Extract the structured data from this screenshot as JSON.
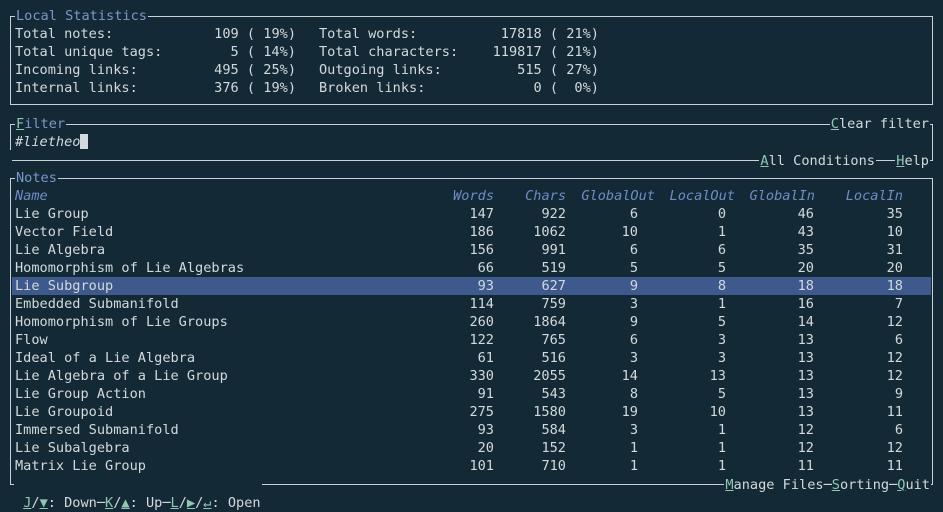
{
  "stats": {
    "title": "Local Statistics",
    "rows": [
      {
        "l1": "Total notes:",
        "v1": "109 ( 19%)",
        "l2": "Total words:",
        "v2": "17818 ( 21%)"
      },
      {
        "l1": "Total unique tags:",
        "v1": "5 ( 14%)",
        "l2": "Total characters:",
        "v2": "119817 ( 21%)"
      },
      {
        "l1": "Incoming links:",
        "v1": "495 ( 25%)",
        "l2": "Outgoing links:",
        "v2": "515 ( 27%)"
      },
      {
        "l1": "Internal links:",
        "v1": "376 ( 19%)",
        "l2": "Broken links:",
        "v2": "0 (  0%)"
      }
    ]
  },
  "filter": {
    "title_key": "F",
    "title_rest": "ilter",
    "value": "#lietheo",
    "clear_key": "C",
    "clear_rest": "lear filter",
    "all_key": "A",
    "all_rest": "ll Conditions",
    "help_key": "H",
    "help_rest": "elp"
  },
  "notes": {
    "title": "Notes",
    "headers": [
      "Name",
      "Words",
      "Chars",
      "GlobalOut",
      "LocalOut",
      "GlobalIn",
      "LocalIn"
    ],
    "rows": [
      [
        "Lie Group",
        "147",
        "922",
        "6",
        "0",
        "46",
        "35"
      ],
      [
        "Vector Field",
        "186",
        "1062",
        "10",
        "1",
        "43",
        "10"
      ],
      [
        "Lie Algebra",
        "156",
        "991",
        "6",
        "6",
        "35",
        "31"
      ],
      [
        "Homomorphism of Lie Algebras",
        "66",
        "519",
        "5",
        "5",
        "20",
        "20"
      ],
      [
        "Lie Subgroup",
        "93",
        "627",
        "9",
        "8",
        "18",
        "18"
      ],
      [
        "Embedded Submanifold",
        "114",
        "759",
        "3",
        "1",
        "16",
        "7"
      ],
      [
        "Homomorphism of Lie Groups",
        "260",
        "1864",
        "9",
        "5",
        "14",
        "12"
      ],
      [
        "Flow",
        "122",
        "765",
        "6",
        "3",
        "13",
        "6"
      ],
      [
        "Ideal of a Lie Algebra",
        "61",
        "516",
        "3",
        "3",
        "13",
        "12"
      ],
      [
        "Lie Algebra of a Lie Group",
        "330",
        "2055",
        "14",
        "13",
        "13",
        "12"
      ],
      [
        "Lie Group Action",
        "91",
        "543",
        "8",
        "5",
        "13",
        "9"
      ],
      [
        "Lie Groupoid",
        "275",
        "1580",
        "19",
        "10",
        "13",
        "11"
      ],
      [
        "Immersed Submanifold",
        "93",
        "584",
        "3",
        "1",
        "12",
        "6"
      ],
      [
        "Lie Subalgebra",
        "20",
        "152",
        "1",
        "1",
        "12",
        "12"
      ],
      [
        "Matrix Lie Group",
        "101",
        "710",
        "1",
        "1",
        "11",
        "11"
      ]
    ],
    "selected_index": 4
  },
  "footer": {
    "down_key": "J",
    "down_arrow": "▼",
    "down": ": Down",
    "up_key": "K",
    "up_arrow": "▲",
    "up": ": Up",
    "open_key": "L",
    "open_arrow": "▶",
    "open_enter": "↵",
    "open": ": Open",
    "manage_key": "M",
    "manage_rest": "anage Files",
    "sort_key": "S",
    "sort_rest": "orting",
    "quit_key": "Q",
    "quit_rest": "uit"
  }
}
